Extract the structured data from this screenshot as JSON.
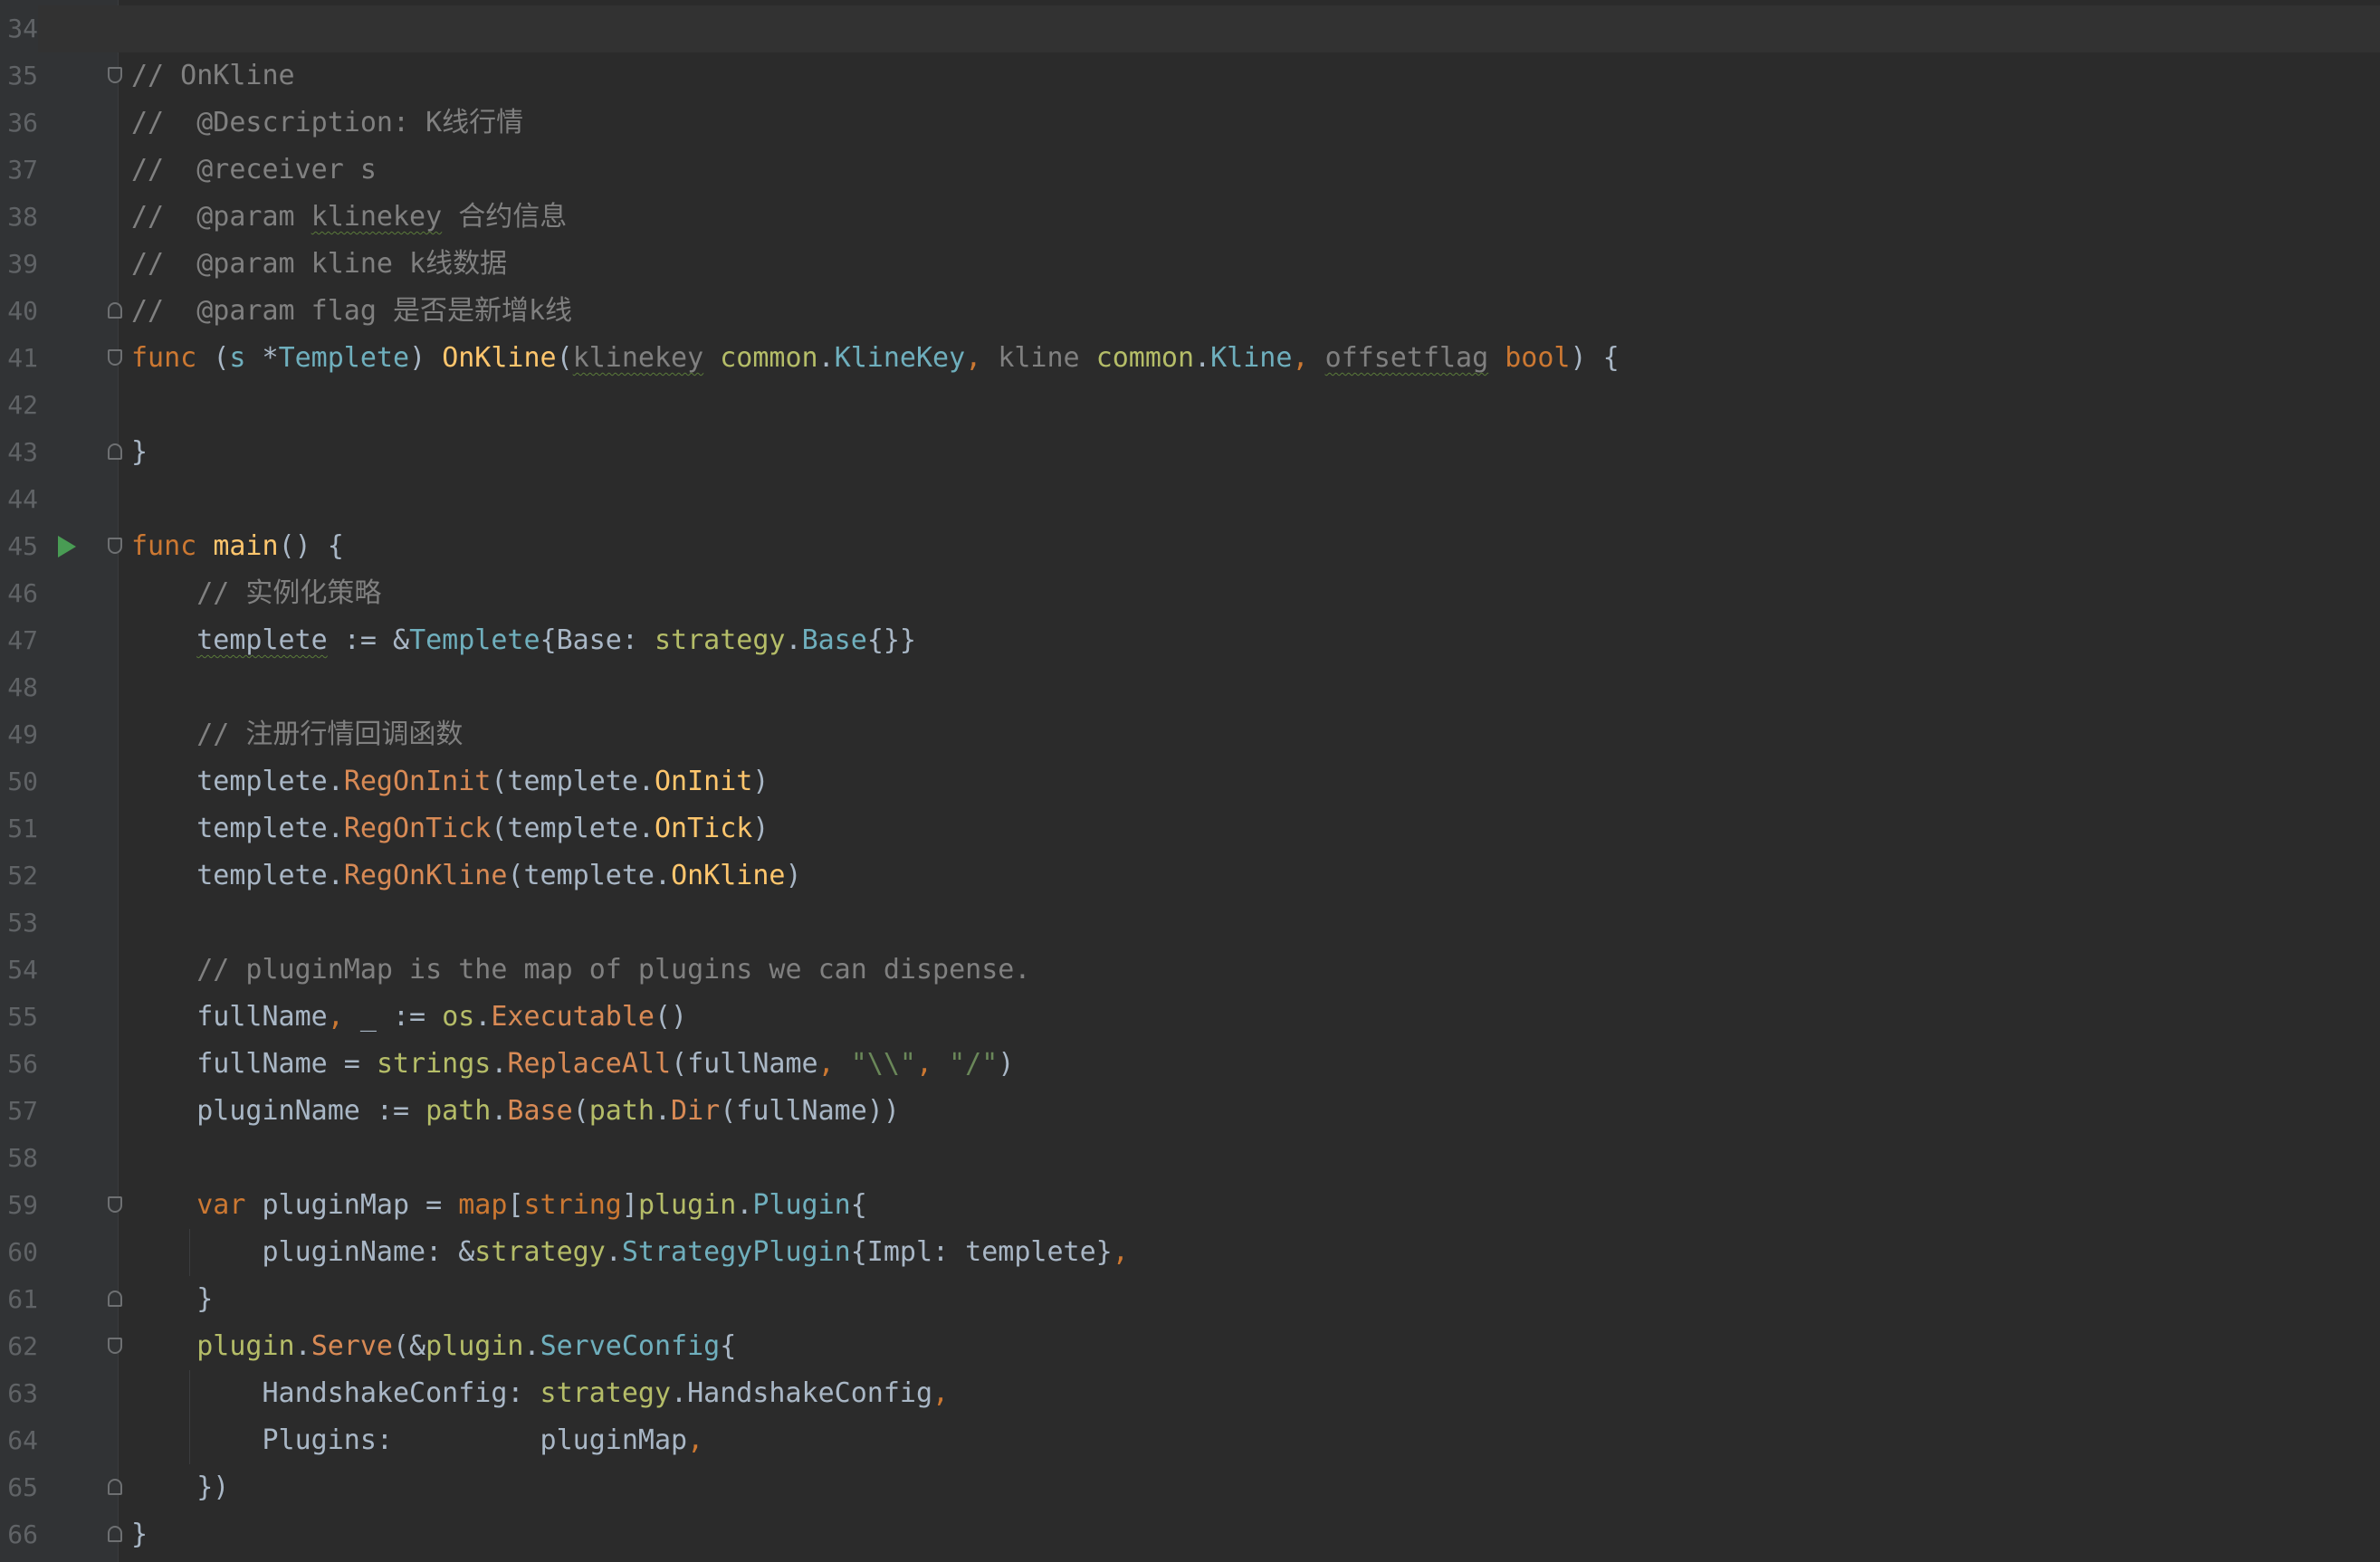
{
  "editor": {
    "language": "go",
    "current_line": 34,
    "colors": {
      "background": "#2b2b2b",
      "gutter": "#313335",
      "keyword": "#cc7832",
      "function": "#ffc66d",
      "type": "#6fafbd",
      "comment": "#808080",
      "string": "#6a8759",
      "package": "#b5bd68",
      "text": "#a9b7c6",
      "line_number": "#606366",
      "run_icon": "#499c54"
    },
    "lines": [
      {
        "n": 34,
        "tokens": []
      },
      {
        "n": 35,
        "fold": "start",
        "tokens": [
          {
            "t": "// OnKline",
            "c": "com"
          }
        ]
      },
      {
        "n": 36,
        "tokens": [
          {
            "t": "//  @Description: K线行情",
            "c": "com"
          }
        ]
      },
      {
        "n": 37,
        "tokens": [
          {
            "t": "//  @receiver s",
            "c": "com"
          }
        ]
      },
      {
        "n": 38,
        "tokens": [
          {
            "t": "//  @param ",
            "c": "com"
          },
          {
            "t": "klinekey",
            "c": "com",
            "sq": true
          },
          {
            "t": " 合约信息",
            "c": "com"
          }
        ]
      },
      {
        "n": 39,
        "tokens": [
          {
            "t": "//  @param kline k线数据",
            "c": "com"
          }
        ]
      },
      {
        "n": 40,
        "fold": "end",
        "tokens": [
          {
            "t": "//  @param flag 是否是新增k线",
            "c": "com"
          }
        ]
      },
      {
        "n": 41,
        "fold": "start",
        "tokens": [
          {
            "t": "func ",
            "c": "kw"
          },
          {
            "t": "(",
            "c": "txt"
          },
          {
            "t": "s ",
            "c": "type"
          },
          {
            "t": "*",
            "c": "txt"
          },
          {
            "t": "Templete",
            "c": "type"
          },
          {
            "t": ") ",
            "c": "txt"
          },
          {
            "t": "OnKline",
            "c": "fn"
          },
          {
            "t": "(",
            "c": "txt"
          },
          {
            "t": "klinekey",
            "c": "ph",
            "sq": true
          },
          {
            "t": " ",
            "c": "txt"
          },
          {
            "t": "common",
            "c": "pkg"
          },
          {
            "t": ".",
            "c": "txt"
          },
          {
            "t": "KlineKey",
            "c": "type"
          },
          {
            "t": ", ",
            "c": "punc"
          },
          {
            "t": "kline ",
            "c": "ph"
          },
          {
            "t": "common",
            "c": "pkg"
          },
          {
            "t": ".",
            "c": "txt"
          },
          {
            "t": "Kline",
            "c": "type"
          },
          {
            "t": ", ",
            "c": "punc"
          },
          {
            "t": "offsetflag",
            "c": "ph",
            "sq": true
          },
          {
            "t": " ",
            "c": "txt"
          },
          {
            "t": "bool",
            "c": "kw"
          },
          {
            "t": ") {",
            "c": "txt"
          }
        ]
      },
      {
        "n": 42,
        "tokens": []
      },
      {
        "n": 43,
        "fold": "end",
        "tokens": [
          {
            "t": "}",
            "c": "txt"
          }
        ]
      },
      {
        "n": 44,
        "tokens": []
      },
      {
        "n": 45,
        "fold": "start",
        "run": true,
        "tokens": [
          {
            "t": "func ",
            "c": "kw"
          },
          {
            "t": "main",
            "c": "fn"
          },
          {
            "t": "() {",
            "c": "txt"
          }
        ]
      },
      {
        "n": 46,
        "tokens": [
          {
            "t": "    // 实例化策略",
            "c": "com"
          }
        ]
      },
      {
        "n": 47,
        "tokens": [
          {
            "t": "    ",
            "c": "txt"
          },
          {
            "t": "templete",
            "c": "txt",
            "sq": true
          },
          {
            "t": " := &",
            "c": "txt"
          },
          {
            "t": "Templete",
            "c": "type"
          },
          {
            "t": "{Base: ",
            "c": "txt"
          },
          {
            "t": "strategy",
            "c": "pkg"
          },
          {
            "t": ".",
            "c": "txt"
          },
          {
            "t": "Base",
            "c": "type"
          },
          {
            "t": "{}}",
            "c": "txt"
          }
        ]
      },
      {
        "n": 48,
        "tokens": []
      },
      {
        "n": 49,
        "tokens": [
          {
            "t": "    // 注册行情回调函数",
            "c": "com"
          }
        ]
      },
      {
        "n": 50,
        "tokens": [
          {
            "t": "    templete.",
            "c": "txt"
          },
          {
            "t": "RegOnInit",
            "c": "kwfn"
          },
          {
            "t": "(templete.",
            "c": "txt"
          },
          {
            "t": "OnInit",
            "c": "fn"
          },
          {
            "t": ")",
            "c": "txt"
          }
        ]
      },
      {
        "n": 51,
        "tokens": [
          {
            "t": "    templete.",
            "c": "txt"
          },
          {
            "t": "RegOnTick",
            "c": "kwfn"
          },
          {
            "t": "(templete.",
            "c": "txt"
          },
          {
            "t": "OnTick",
            "c": "fn"
          },
          {
            "t": ")",
            "c": "txt"
          }
        ]
      },
      {
        "n": 52,
        "tokens": [
          {
            "t": "    templete.",
            "c": "txt"
          },
          {
            "t": "RegOnKline",
            "c": "kwfn"
          },
          {
            "t": "(templete.",
            "c": "txt"
          },
          {
            "t": "OnKline",
            "c": "fn"
          },
          {
            "t": ")",
            "c": "txt"
          }
        ]
      },
      {
        "n": 53,
        "tokens": []
      },
      {
        "n": 54,
        "tokens": [
          {
            "t": "    // pluginMap is the map of plugins we can dispense.",
            "c": "com"
          }
        ]
      },
      {
        "n": 55,
        "tokens": [
          {
            "t": "    fullName",
            "c": "txt"
          },
          {
            "t": ", ",
            "c": "punc"
          },
          {
            "t": "_ := ",
            "c": "txt"
          },
          {
            "t": "os",
            "c": "pkg"
          },
          {
            "t": ".",
            "c": "txt"
          },
          {
            "t": "Executable",
            "c": "kwfn"
          },
          {
            "t": "()",
            "c": "txt"
          }
        ]
      },
      {
        "n": 56,
        "tokens": [
          {
            "t": "    fullName = ",
            "c": "txt"
          },
          {
            "t": "strings",
            "c": "pkg"
          },
          {
            "t": ".",
            "c": "txt"
          },
          {
            "t": "ReplaceAll",
            "c": "kwfn"
          },
          {
            "t": "(fullName",
            "c": "txt"
          },
          {
            "t": ", ",
            "c": "punc"
          },
          {
            "t": "\"\\\\\"",
            "c": "str"
          },
          {
            "t": ", ",
            "c": "punc"
          },
          {
            "t": "\"/\"",
            "c": "str"
          },
          {
            "t": ")",
            "c": "txt"
          }
        ]
      },
      {
        "n": 57,
        "tokens": [
          {
            "t": "    pluginName := ",
            "c": "txt"
          },
          {
            "t": "path",
            "c": "pkg"
          },
          {
            "t": ".",
            "c": "txt"
          },
          {
            "t": "Base",
            "c": "kwfn"
          },
          {
            "t": "(",
            "c": "txt"
          },
          {
            "t": "path",
            "c": "pkg"
          },
          {
            "t": ".",
            "c": "txt"
          },
          {
            "t": "Dir",
            "c": "kwfn"
          },
          {
            "t": "(fullName))",
            "c": "txt"
          }
        ]
      },
      {
        "n": 58,
        "tokens": []
      },
      {
        "n": 59,
        "fold": "start",
        "tokens": [
          {
            "t": "    ",
            "c": "txt"
          },
          {
            "t": "var ",
            "c": "kw"
          },
          {
            "t": "pluginMap = ",
            "c": "txt"
          },
          {
            "t": "map",
            "c": "kw"
          },
          {
            "t": "[",
            "c": "txt"
          },
          {
            "t": "string",
            "c": "kw"
          },
          {
            "t": "]",
            "c": "txt"
          },
          {
            "t": "plugin",
            "c": "pkg"
          },
          {
            "t": ".",
            "c": "txt"
          },
          {
            "t": "Plugin",
            "c": "type"
          },
          {
            "t": "{",
            "c": "txt"
          }
        ]
      },
      {
        "n": 60,
        "guide": true,
        "tokens": [
          {
            "t": "        pluginName: &",
            "c": "txt"
          },
          {
            "t": "strategy",
            "c": "pkg"
          },
          {
            "t": ".",
            "c": "txt"
          },
          {
            "t": "StrategyPlugin",
            "c": "type"
          },
          {
            "t": "{Impl: templete}",
            "c": "txt"
          },
          {
            "t": ",",
            "c": "punc"
          }
        ]
      },
      {
        "n": 61,
        "fold": "end",
        "tokens": [
          {
            "t": "    }",
            "c": "txt"
          }
        ]
      },
      {
        "n": 62,
        "fold": "start",
        "tokens": [
          {
            "t": "    ",
            "c": "txt"
          },
          {
            "t": "plugin",
            "c": "pkg"
          },
          {
            "t": ".",
            "c": "txt"
          },
          {
            "t": "Serve",
            "c": "kwfn"
          },
          {
            "t": "(&",
            "c": "txt"
          },
          {
            "t": "plugin",
            "c": "pkg"
          },
          {
            "t": ".",
            "c": "txt"
          },
          {
            "t": "ServeConfig",
            "c": "type"
          },
          {
            "t": "{",
            "c": "txt"
          }
        ]
      },
      {
        "n": 63,
        "guide": true,
        "tokens": [
          {
            "t": "        HandshakeConfig: ",
            "c": "txt"
          },
          {
            "t": "strategy",
            "c": "pkg"
          },
          {
            "t": ".HandshakeConfig",
            "c": "txt"
          },
          {
            "t": ",",
            "c": "punc"
          }
        ]
      },
      {
        "n": 64,
        "guide": true,
        "tokens": [
          {
            "t": "        Plugins:         pluginMap",
            "c": "txt"
          },
          {
            "t": ",",
            "c": "punc"
          }
        ]
      },
      {
        "n": 65,
        "fold": "end",
        "tokens": [
          {
            "t": "    })",
            "c": "txt"
          }
        ]
      },
      {
        "n": 66,
        "fold": "end",
        "tokens": [
          {
            "t": "}",
            "c": "txt"
          }
        ]
      }
    ]
  }
}
